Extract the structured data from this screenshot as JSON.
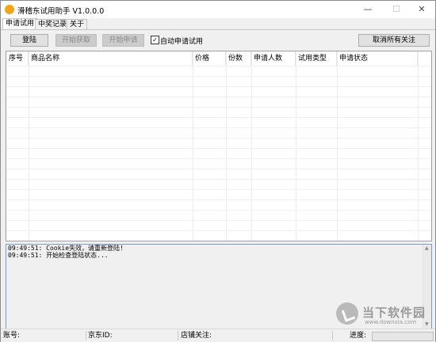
{
  "window": {
    "title": "滑稽东试用助手 V1.0.0.0",
    "minimize": "—",
    "maximize": "☐",
    "close": "✕"
  },
  "tabs": [
    {
      "label": "申请试用",
      "active": true
    },
    {
      "label": "中奖记录",
      "active": false
    },
    {
      "label": "关于",
      "active": false
    }
  ],
  "toolbar": {
    "login": "登陆",
    "start_fetch": "开始获取",
    "start_apply": "开始申请",
    "auto_apply_label": "自动申请试用",
    "auto_apply_checked": true,
    "cancel_all_follow": "取消所有关注"
  },
  "table": {
    "columns": [
      "序号",
      "商品名称",
      "价格",
      "份数",
      "申请人数",
      "试用类型",
      "申请状态"
    ],
    "rows": []
  },
  "log": {
    "lines": [
      "09:49:51: Cookie失效，请重新登陆!",
      "09:49:51: 开始检查登陆状态..."
    ]
  },
  "statusbar": {
    "account_label": "账号:",
    "jd_id_label": "京东ID:",
    "shop_follow_label": "店铺关注:",
    "progress_label": "进度:",
    "progress_value": 0
  },
  "watermark": {
    "name": "当下软件园",
    "url": "www.downxia.com"
  },
  "colors": {
    "progress_fill": "#06b025",
    "log_border": "#7a9cc8",
    "app_icon": "#f2a516"
  }
}
